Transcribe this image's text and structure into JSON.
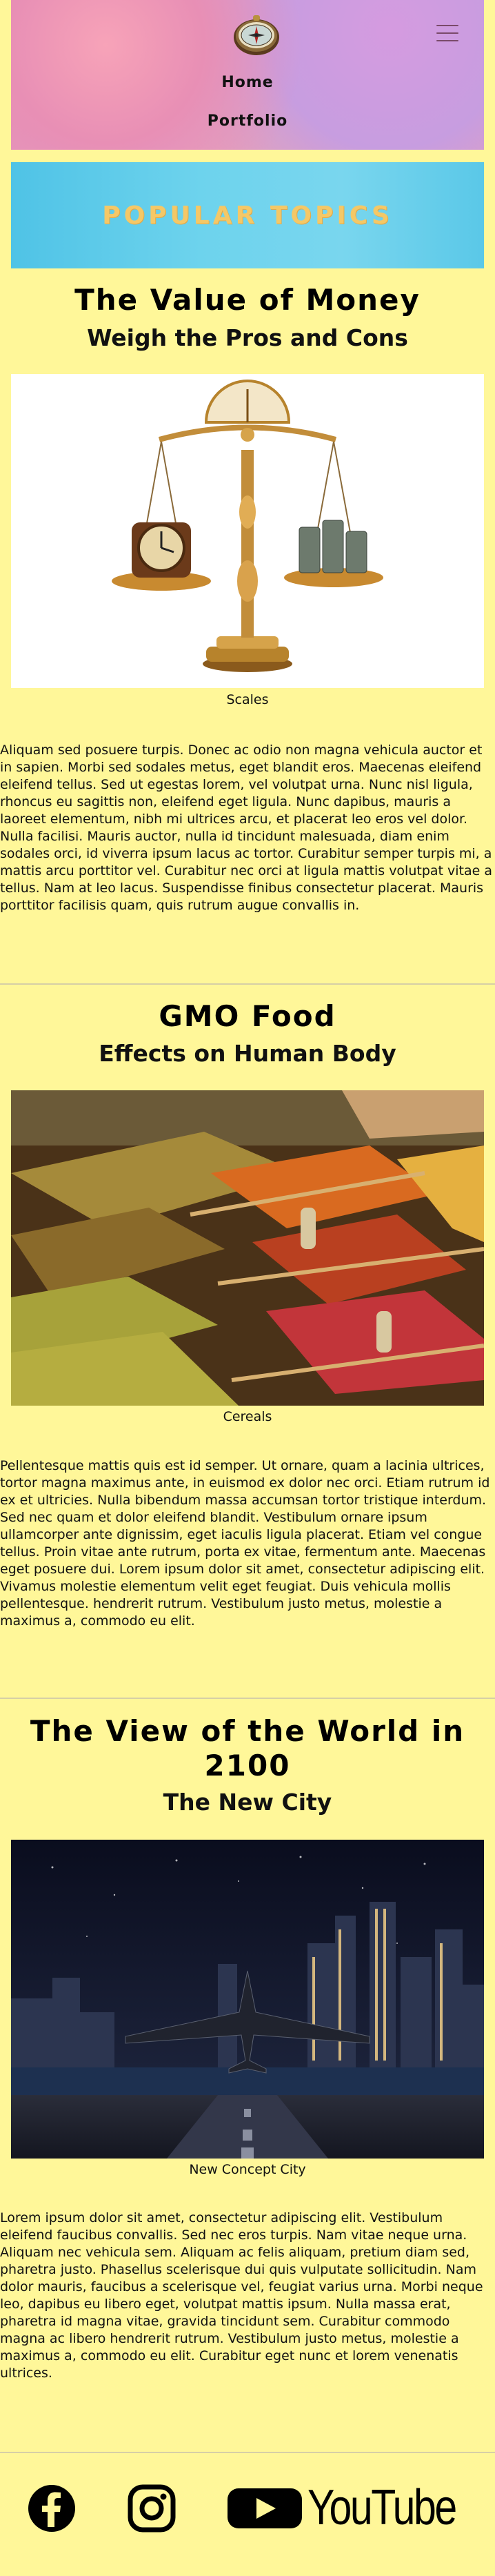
{
  "nav": {
    "home": "Home",
    "portfolio": "Portfolio"
  },
  "banner": {
    "title": "POPULAR TOPICS"
  },
  "articles": [
    {
      "title": "The Value of Money",
      "subtitle": "Weigh the Pros and Cons",
      "caption": "Scales",
      "body": "Aliquam sed posuere turpis. Donec ac odio non magna vehicula auctor et in sapien. Morbi sed sodales metus, eget blandit eros. Maecenas eleifend eleifend tellus. Sed ut egestas lorem, vel volutpat urna. Nunc nisl ligula, rhoncus eu sagittis non, eleifend eget ligula. Nunc dapibus, mauris a laoreet elementum, nibh mi ultrices arcu, et placerat leo eros vel dolor. Nulla facilisi. Mauris auctor, nulla id tincidunt malesuada, diam enim sodales orci, id viverra ipsum lacus ac tortor. Curabitur semper turpis mi, a mattis arcu porttitor vel. Curabitur nec orci at ligula mattis volutpat vitae a tellus. Nam at leo lacus. Suspendisse finibus consectetur placerat. Mauris porttitor facilisis quam, quis rutrum augue convallis in."
    },
    {
      "title": "GMO Food",
      "subtitle": "Effects on Human Body",
      "caption": "Cereals",
      "body": "Pellentesque mattis quis est id semper. Ut ornare, quam a lacinia ultrices, tortor magna maximus ante, in euismod ex dolor nec orci. Etiam rutrum id ex et ultricies. Nulla bibendum massa accumsan tortor tristique interdum. Sed nec quam et dolor eleifend blandit. Vestibulum ornare ipsum ullamcorper ante dignissim, eget iaculis ligula placerat. Etiam vel congue tellus. Proin vitae ante rutrum, porta ex vitae, fermentum ante. Maecenas eget posuere dui. Lorem ipsum dolor sit amet, consectetur adipiscing elit. Vivamus molestie elementum velit eget feugiat. Duis vehicula mollis pellentesque. hendrerit rutrum. Vestibulum justo metus, molestie a maximus a, commodo eu elit."
    },
    {
      "title": "The View of the World in 2100",
      "subtitle": "The New City",
      "caption": "New Concept City",
      "body": "Lorem ipsum dolor sit amet, consectetur adipiscing elit. Vestibulum eleifend faucibus convallis. Sed nec eros turpis. Nam vitae neque urna. Aliquam nec vehicula sem. Aliquam ac felis aliquam, pretium diam sed, pharetra justo. Phasellus scelerisque dui quis vulputate sollicitudin. Nam dolor mauris, faucibus a scelerisque vel, feugiat varius urna. Morbi neque leo, dapibus eu libero eget, volutpat mattis ipsum. Nulla massa erat, pharetra id magna vitae, gravida tincidunt sem. Curabitur commodo magna ac libero hendrerit rutrum. Vestibulum justo metus, molestie a maximus a, commodo eu elit. Curabitur eget nunc et lorem venenatis ultrices."
    }
  ],
  "social": {
    "youtube_label": "YouTube"
  },
  "icons": [
    "compass-icon",
    "menu-icon",
    "facebook-icon",
    "instagram-icon",
    "youtube-icon"
  ],
  "colors": {
    "background": "#fff799",
    "banner_text": "#f4c867",
    "banner_bg": "#5ac8e8"
  }
}
